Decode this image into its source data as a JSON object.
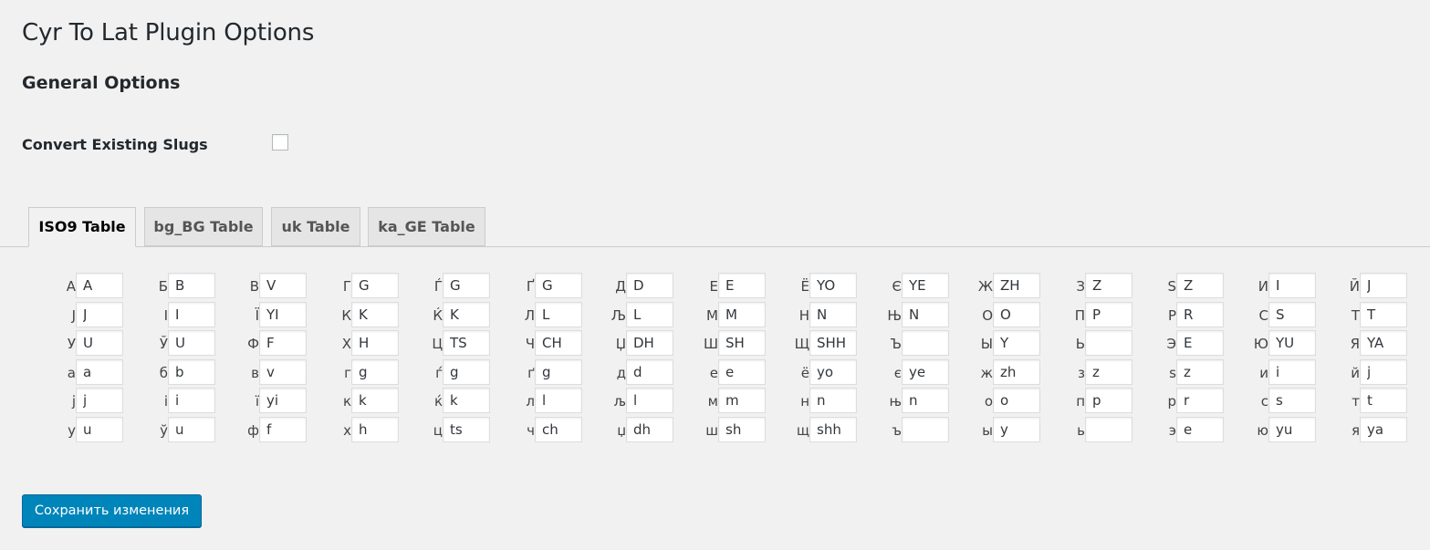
{
  "page_title": "Cyr To Lat Plugin Options",
  "section_title": "General Options",
  "convert_existing_slugs": {
    "label": "Convert Existing Slugs",
    "checked": false
  },
  "tabs": [
    {
      "label": "ISO9 Table",
      "active": true
    },
    {
      "label": "bg_BG Table",
      "active": false
    },
    {
      "label": "uk Table",
      "active": false
    },
    {
      "label": "ka_GE Table",
      "active": false
    }
  ],
  "table": [
    [
      [
        "А",
        "A"
      ],
      [
        "Б",
        "B"
      ],
      [
        "В",
        "V"
      ],
      [
        "Г",
        "G"
      ],
      [
        "Ѓ",
        "G"
      ],
      [
        "Ґ",
        "G"
      ],
      [
        "Д",
        "D"
      ],
      [
        "Е",
        "E"
      ],
      [
        "Ё",
        "YO"
      ],
      [
        "Є",
        "YE"
      ],
      [
        "Ж",
        "ZH"
      ],
      [
        "З",
        "Z"
      ],
      [
        "Ѕ",
        "Z"
      ],
      [
        "И",
        "I"
      ],
      [
        "Й",
        "J"
      ]
    ],
    [
      [
        "Ј",
        "J"
      ],
      [
        "І",
        "I"
      ],
      [
        "Ї",
        "YI"
      ],
      [
        "К",
        "K"
      ],
      [
        "Ќ",
        "K"
      ],
      [
        "Л",
        "L"
      ],
      [
        "Љ",
        "L"
      ],
      [
        "М",
        "M"
      ],
      [
        "Н",
        "N"
      ],
      [
        "Њ",
        "N"
      ],
      [
        "О",
        "O"
      ],
      [
        "П",
        "P"
      ],
      [
        "Р",
        "R"
      ],
      [
        "С",
        "S"
      ],
      [
        "Т",
        "T"
      ]
    ],
    [
      [
        "У",
        "U"
      ],
      [
        "Ў",
        "U"
      ],
      [
        "Ф",
        "F"
      ],
      [
        "Х",
        "H"
      ],
      [
        "Ц",
        "TS"
      ],
      [
        "Ч",
        "CH"
      ],
      [
        "Џ",
        "DH"
      ],
      [
        "Ш",
        "SH"
      ],
      [
        "Щ",
        "SHH"
      ],
      [
        "Ъ",
        ""
      ],
      [
        "Ы",
        "Y"
      ],
      [
        "Ь",
        ""
      ],
      [
        "Э",
        "E"
      ],
      [
        "Ю",
        "YU"
      ],
      [
        "Я",
        "YA"
      ]
    ],
    [
      [
        "а",
        "a"
      ],
      [
        "б",
        "b"
      ],
      [
        "в",
        "v"
      ],
      [
        "г",
        "g"
      ],
      [
        "ѓ",
        "g"
      ],
      [
        "ґ",
        "g"
      ],
      [
        "д",
        "d"
      ],
      [
        "е",
        "e"
      ],
      [
        "ё",
        "yo"
      ],
      [
        "є",
        "ye"
      ],
      [
        "ж",
        "zh"
      ],
      [
        "з",
        "z"
      ],
      [
        "ѕ",
        "z"
      ],
      [
        "и",
        "i"
      ],
      [
        "й",
        "j"
      ]
    ],
    [
      [
        "ј",
        "j"
      ],
      [
        "і",
        "i"
      ],
      [
        "ї",
        "yi"
      ],
      [
        "к",
        "k"
      ],
      [
        "ќ",
        "k"
      ],
      [
        "л",
        "l"
      ],
      [
        "љ",
        "l"
      ],
      [
        "м",
        "m"
      ],
      [
        "н",
        "n"
      ],
      [
        "њ",
        "n"
      ],
      [
        "о",
        "o"
      ],
      [
        "п",
        "p"
      ],
      [
        "р",
        "r"
      ],
      [
        "с",
        "s"
      ],
      [
        "т",
        "t"
      ]
    ],
    [
      [
        "у",
        "u"
      ],
      [
        "ў",
        "u"
      ],
      [
        "ф",
        "f"
      ],
      [
        "х",
        "h"
      ],
      [
        "ц",
        "ts"
      ],
      [
        "ч",
        "ch"
      ],
      [
        "џ",
        "dh"
      ],
      [
        "ш",
        "sh"
      ],
      [
        "щ",
        "shh"
      ],
      [
        "ъ",
        ""
      ],
      [
        "ы",
        "y"
      ],
      [
        "ь",
        ""
      ],
      [
        "э",
        "e"
      ],
      [
        "ю",
        "yu"
      ],
      [
        "я",
        "ya"
      ]
    ]
  ],
  "save_button_label": "Сохранить изменения",
  "colors": {
    "background": "#f1f1f1",
    "primary_button": "#0085ba",
    "tab_inactive": "#e5e5e5"
  }
}
